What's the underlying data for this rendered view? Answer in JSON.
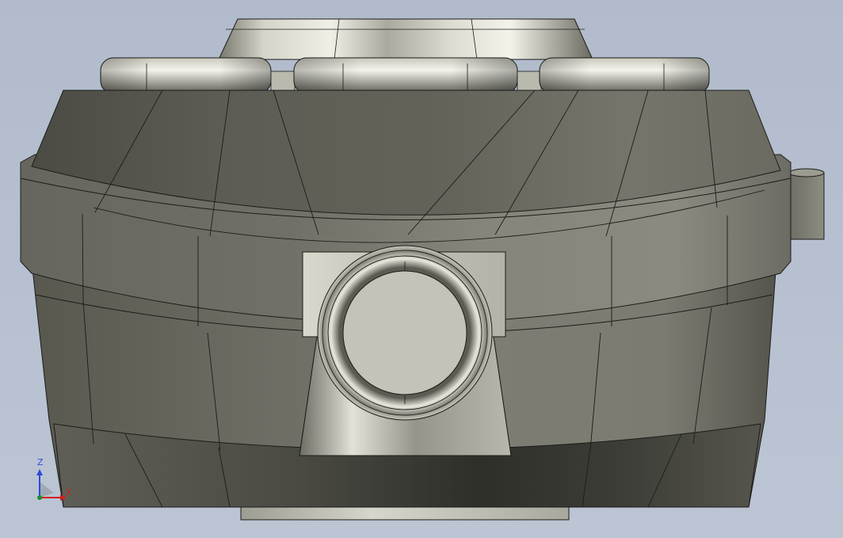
{
  "viewport": {
    "background_top": "#b1bbcb",
    "background_bottom": "#bcc5d4",
    "model_body_color": "#6f6f65",
    "model_metal_color": "#cfcfc4",
    "edge_color": "#1c1c1a"
  },
  "triad": {
    "z_label": "Z",
    "x_label": "X",
    "z_color": "#2c4bd6",
    "x_color": "#cf2020"
  }
}
